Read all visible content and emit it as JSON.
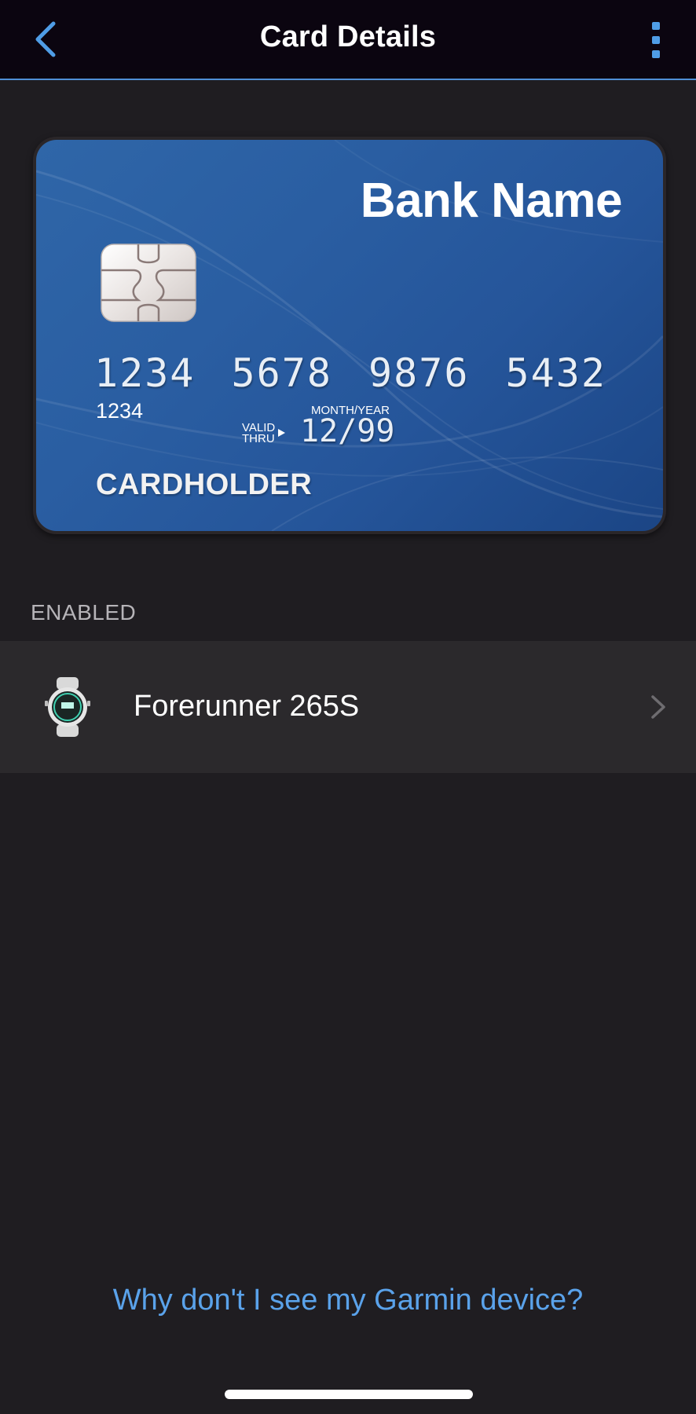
{
  "header": {
    "title": "Card Details",
    "back_icon": "chevron-left-icon",
    "menu_icon": "more-vertical-icon",
    "accent_color": "#4f9de6"
  },
  "card": {
    "bank_name": "Bank Name",
    "number": "1234 5678 9876 5432",
    "small_number": "1234",
    "month_year_label": "MONTH/YEAR",
    "valid_thru_line1": "VALID",
    "valid_thru_line2": "THRU",
    "expiry": "12/99",
    "cardholder": "CARDHOLDER",
    "card_color": "#2a5ea2"
  },
  "enabled_section": {
    "label": "ENABLED",
    "devices": [
      {
        "name": "Forerunner 265S",
        "icon": "watch-icon"
      }
    ]
  },
  "help": {
    "link_text": "Why don't I see my Garmin device?",
    "link_color": "#5aa2ea"
  }
}
